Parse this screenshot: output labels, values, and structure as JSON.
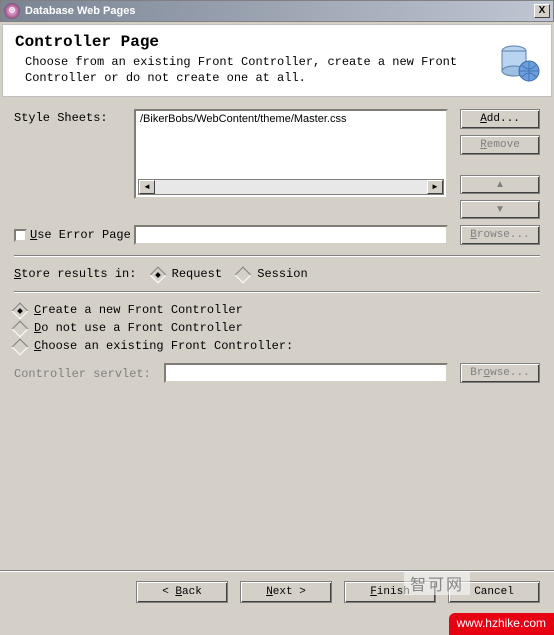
{
  "titlebar": {
    "title": "Database Web Pages",
    "close": "X"
  },
  "header": {
    "title": "Controller Page",
    "desc": "Choose from an existing Front Controller, create a new Front Controller or do not create one at all."
  },
  "styles": {
    "label": "Style Sheets:",
    "items": [
      "/BikerBobs/WebContent/theme/Master.css"
    ],
    "buttons": {
      "add": "Add...",
      "remove": "Remove",
      "up": "▲",
      "down": "▼"
    }
  },
  "error": {
    "checkbox_label_pre": "U",
    "checkbox_label_rest": "se Error Page",
    "browse": "Browse..."
  },
  "store": {
    "label_pre": "S",
    "label_rest": "tore results in:",
    "opt_request": "Request",
    "opt_session": "Session"
  },
  "controller": {
    "opt_create_pre": "C",
    "opt_create_rest": "reate a new Front Controller",
    "opt_none_pre": "D",
    "opt_none_rest": "o not use a Front Controller",
    "opt_existing_pre": "C",
    "opt_existing_rest": "hoose an existing Front Controller:",
    "servlet_label": "Controller servlet:",
    "browse": "Browse..."
  },
  "footer": {
    "back": "< Back",
    "next": "Next >",
    "finish": "Finish",
    "cancel": "Cancel"
  },
  "watermark": {
    "light": "智可网",
    "red": "www.hzhike.com"
  }
}
